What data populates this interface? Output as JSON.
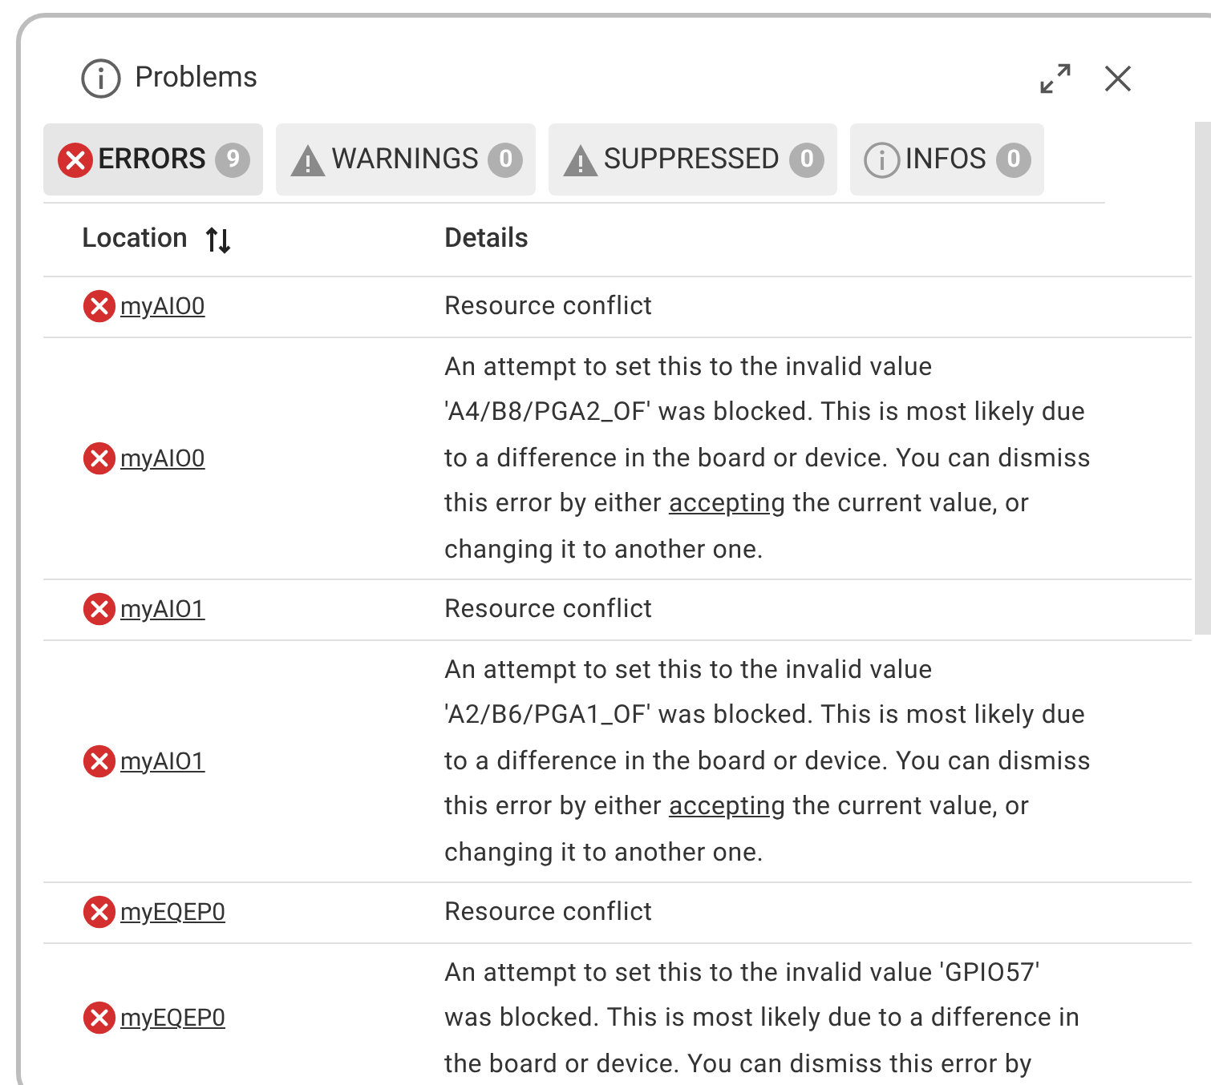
{
  "panel": {
    "title": "Problems"
  },
  "tabs": [
    {
      "kind": "error",
      "label": "ERRORS",
      "count": "9",
      "selected": true
    },
    {
      "kind": "warning",
      "label": "WARNINGS",
      "count": "0",
      "selected": false
    },
    {
      "kind": "warning",
      "label": "SUPPRESSED",
      "count": "0",
      "selected": false
    },
    {
      "kind": "info",
      "label": "INFOS",
      "count": "0",
      "selected": false
    }
  ],
  "table": {
    "columns": [
      "Location",
      "Details"
    ],
    "rows": [
      {
        "location": "myAIO0",
        "details": [
          {
            "text": "Resource conflict",
            "link": false
          }
        ]
      },
      {
        "location": "myAIO0",
        "details": [
          {
            "text": "An attempt to set this to the invalid value 'A4/B8/PGA2_OF' was blocked. This is most likely due to a difference in the board or device. You can dismiss this error by either ",
            "link": false
          },
          {
            "text": "accepting",
            "link": true
          },
          {
            "text": " the current value, or changing it to another one.",
            "link": false
          }
        ]
      },
      {
        "location": "myAIO1",
        "details": [
          {
            "text": "Resource conflict",
            "link": false
          }
        ]
      },
      {
        "location": "myAIO1",
        "details": [
          {
            "text": "An attempt to set this to the invalid value 'A2/B6/PGA1_OF' was blocked. This is most likely due to a difference in the board or device. You can dismiss this error by either ",
            "link": false
          },
          {
            "text": "accepting",
            "link": true
          },
          {
            "text": " the current value, or changing it to another one.",
            "link": false
          }
        ]
      },
      {
        "location": "myEQEP0",
        "details": [
          {
            "text": "Resource conflict",
            "link": false
          }
        ]
      },
      {
        "location": "myEQEP0",
        "details": [
          {
            "text": "An attempt to set this to the invalid value 'GPIO57' was blocked. This is most likely due to a difference in the board or device. You can dismiss this error by",
            "link": false
          }
        ]
      }
    ]
  }
}
